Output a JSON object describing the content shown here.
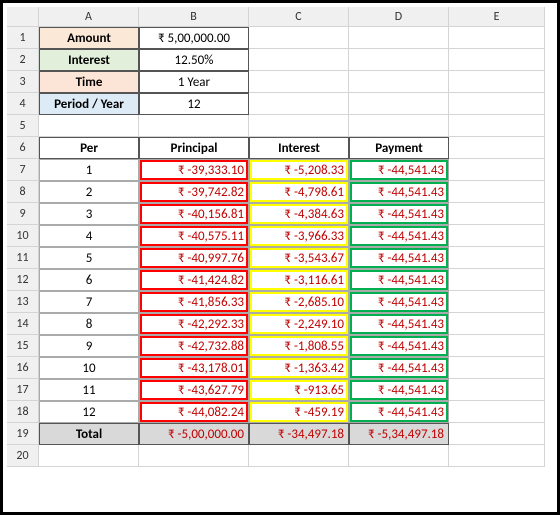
{
  "columns": [
    "A",
    "B",
    "C",
    "D",
    "E"
  ],
  "row_numbers": [
    "1",
    "2",
    "3",
    "4",
    "5",
    "6",
    "7",
    "8",
    "9",
    "10",
    "11",
    "12",
    "13",
    "14",
    "15",
    "16",
    "17",
    "18",
    "19",
    "20"
  ],
  "inputs": {
    "amount_label": "Amount",
    "amount_value": "₹ 5,00,000.00",
    "interest_label": "Interest",
    "interest_value": "12.50%",
    "time_label": "Time",
    "time_value": "1 Year",
    "period_label": "Period / Year",
    "period_value": "12"
  },
  "headers": {
    "per": "Per",
    "principal": "Principal",
    "interest": "Interest",
    "payment": "Payment"
  },
  "rows": [
    {
      "per": "1",
      "principal": "₹ -39,333.10",
      "interest": "₹ -5,208.33",
      "payment": "₹ -44,541.43"
    },
    {
      "per": "2",
      "principal": "₹ -39,742.82",
      "interest": "₹ -4,798.61",
      "payment": "₹ -44,541.43"
    },
    {
      "per": "3",
      "principal": "₹ -40,156.81",
      "interest": "₹ -4,384.63",
      "payment": "₹ -44,541.43"
    },
    {
      "per": "4",
      "principal": "₹ -40,575.11",
      "interest": "₹ -3,966.33",
      "payment": "₹ -44,541.43"
    },
    {
      "per": "5",
      "principal": "₹ -40,997.76",
      "interest": "₹ -3,543.67",
      "payment": "₹ -44,541.43"
    },
    {
      "per": "6",
      "principal": "₹ -41,424.82",
      "interest": "₹ -3,116.61",
      "payment": "₹ -44,541.43"
    },
    {
      "per": "7",
      "principal": "₹ -41,856.33",
      "interest": "₹ -2,685.10",
      "payment": "₹ -44,541.43"
    },
    {
      "per": "8",
      "principal": "₹ -42,292.33",
      "interest": "₹ -2,249.10",
      "payment": "₹ -44,541.43"
    },
    {
      "per": "9",
      "principal": "₹ -42,732.88",
      "interest": "₹ -1,808.55",
      "payment": "₹ -44,541.43"
    },
    {
      "per": "10",
      "principal": "₹ -43,178.01",
      "interest": "₹ -1,363.42",
      "payment": "₹ -44,541.43"
    },
    {
      "per": "11",
      "principal": "₹ -43,627.79",
      "interest": "₹ -913.65",
      "payment": "₹ -44,541.43"
    },
    {
      "per": "12",
      "principal": "₹ -44,082.24",
      "interest": "₹ -459.19",
      "payment": "₹ -44,541.43"
    }
  ],
  "totals": {
    "label": "Total",
    "principal": "₹ -5,00,000.00",
    "interest": "₹ -34,497.18",
    "payment": "₹ -5,34,497.18"
  },
  "chart_data": {
    "type": "table",
    "title": "Loan Amortization Schedule",
    "inputs": {
      "amount": 500000,
      "interest_rate": 0.125,
      "time_years": 1,
      "periods_per_year": 12
    },
    "columns": [
      "Per",
      "Principal",
      "Interest",
      "Payment"
    ],
    "rows": [
      [
        1,
        -39333.1,
        -5208.33,
        -44541.43
      ],
      [
        2,
        -39742.82,
        -4798.61,
        -44541.43
      ],
      [
        3,
        -40156.81,
        -4384.63,
        -44541.43
      ],
      [
        4,
        -40575.11,
        -3966.33,
        -44541.43
      ],
      [
        5,
        -40997.76,
        -3543.67,
        -44541.43
      ],
      [
        6,
        -41424.82,
        -3116.61,
        -44541.43
      ],
      [
        7,
        -41856.33,
        -2685.1,
        -44541.43
      ],
      [
        8,
        -42292.33,
        -2249.1,
        -44541.43
      ],
      [
        9,
        -42732.88,
        -1808.55,
        -44541.43
      ],
      [
        10,
        -43178.01,
        -1363.42,
        -44541.43
      ],
      [
        11,
        -43627.79,
        -913.65,
        -44541.43
      ],
      [
        12,
        -44082.24,
        -459.19,
        -44541.43
      ]
    ],
    "totals": {
      "principal": -500000.0,
      "interest": -34497.18,
      "payment": -534497.18
    }
  }
}
